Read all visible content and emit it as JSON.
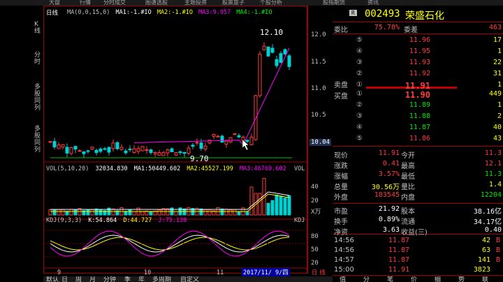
{
  "top_tabs": [
    "大盘",
    "行情",
    "分时成交",
    "图谱选股",
    "主题投资",
    "股票篮子",
    "个股分析",
    "股指期货",
    "资讯"
  ],
  "left_tabs": [
    "K线",
    "分时",
    "多股同列",
    "多股同列"
  ],
  "chart": {
    "period": "日线",
    "ma_legend": [
      {
        "text": "MA(0,0,15,0)",
        "color": "#c0c0c0"
      },
      {
        "text": "MA1:-1.#IO",
        "color": "#ffffff"
      },
      {
        "text": "MA2:-1.#IO",
        "color": "#ffff00"
      },
      {
        "text": "MA3:9.957",
        "color": "#ff00ff"
      },
      {
        "text": "MA4:-1.#IO",
        "color": "#00ff00"
      }
    ],
    "high_label": "12.10",
    "low_label": "9.70",
    "y_ticks": [
      "12.0",
      "11.5",
      "11.0",
      "10.5"
    ],
    "current_price_tag": "10.04",
    "vol_legend": {
      "head": "VOL(5,10,20)",
      "val": "32034.830",
      "ma1": "MA1:50449.602",
      "ma2": "MA2:45527.199",
      "ma3": "MA3:46769.602",
      "label": "VOL"
    },
    "vol_ticks": [
      "40",
      "20"
    ],
    "vol_unit": "X万",
    "kdj_legend": {
      "head": "KDJ(9,3,3)",
      "k": "K:54.864",
      "d": "D:44.727",
      "j": "J:75.138",
      "label": "KDJ"
    },
    "kdj_ticks": [
      "80",
      "50",
      "20"
    ],
    "x_labels": [
      "9",
      "10",
      "11"
    ],
    "date_cursor": "2017/11/ 9/四",
    "bottom_right_label": "日 线"
  },
  "bottom_tabs": [
    "默认",
    "日",
    "周",
    "月",
    "分钟",
    "季",
    "年",
    "多周期",
    "自定义"
  ],
  "quote": {
    "badge": "R",
    "code": "002493",
    "name": "荣盛石化",
    "weibi_label": "委比",
    "weibi": "75.78%",
    "weicha_label": "委差",
    "weicha": "463",
    "sell_label": "卖盘",
    "buy_label": "买盘",
    "asks": [
      {
        "lvl": "⑤",
        "price": "11.96",
        "vol": "17"
      },
      {
        "lvl": "④",
        "price": "11.95",
        "vol": "1"
      },
      {
        "lvl": "③",
        "price": "11.93",
        "vol": "22"
      },
      {
        "lvl": "②",
        "price": "11.92",
        "vol": "31"
      },
      {
        "lvl": "①",
        "price": "11.91",
        "vol": "1"
      }
    ],
    "bids": [
      {
        "lvl": "①",
        "price": "11.90",
        "vol": "449"
      },
      {
        "lvl": "②",
        "price": "11.89",
        "vol": "1"
      },
      {
        "lvl": "③",
        "price": "11.88",
        "vol": "2"
      },
      {
        "lvl": "④",
        "price": "11.87",
        "vol": "40"
      },
      {
        "lvl": "⑤",
        "price": "11.86",
        "vol": "43"
      }
    ],
    "stats": [
      {
        "l1": "现价",
        "v1": "11.91",
        "c1": "red",
        "l2": "今开",
        "v2": "11.3",
        "c2": "red"
      },
      {
        "l1": "涨跌",
        "v1": "0.41",
        "c1": "red",
        "l2": "最高",
        "v2": "12.1",
        "c2": "red"
      },
      {
        "l1": "涨幅",
        "v1": "3.57%",
        "c1": "red",
        "l2": "最低",
        "v2": "11.3",
        "c2": "green"
      },
      {
        "l1": "总量",
        "v1": "30.56万",
        "c1": "yellow",
        "l2": "量比",
        "v2": "1.4",
        "c2": "yellow"
      },
      {
        "l1": "外盘",
        "v1": "183545",
        "c1": "red",
        "l2": "内盘",
        "v2": "12204",
        "c2": "green"
      }
    ],
    "stats2": [
      {
        "l1": "市盈",
        "v1": "21.92",
        "c1": "white",
        "l2": "股本",
        "v2": "38.16亿",
        "c2": "white"
      },
      {
        "l1": "换手",
        "v1": "0.89%",
        "c1": "white",
        "l2": "流通",
        "v2": "34.17亿",
        "c2": "white"
      },
      {
        "l1": "净资",
        "v1": "3.63",
        "c1": "white",
        "l2": "收益(三)",
        "v2": "0.40",
        "c2": "white"
      }
    ],
    "ticks": [
      {
        "t": "14:56",
        "p": "11.87",
        "v": "42",
        "s": "B",
        "sc": "red"
      },
      {
        "t": "14:56",
        "p": "11.87",
        "v": "63",
        "s": "B",
        "sc": "red"
      },
      {
        "t": "14:57",
        "p": "11.87",
        "v": "141",
        "s": "B",
        "sc": "red"
      },
      {
        "t": "15:00",
        "p": "11.91",
        "v": "3823",
        "s": "",
        "sc": "yellow"
      }
    ],
    "panel_tabs": [
      "值",
      "分",
      "笔",
      "价",
      "细",
      "势",
      "联"
    ]
  }
}
